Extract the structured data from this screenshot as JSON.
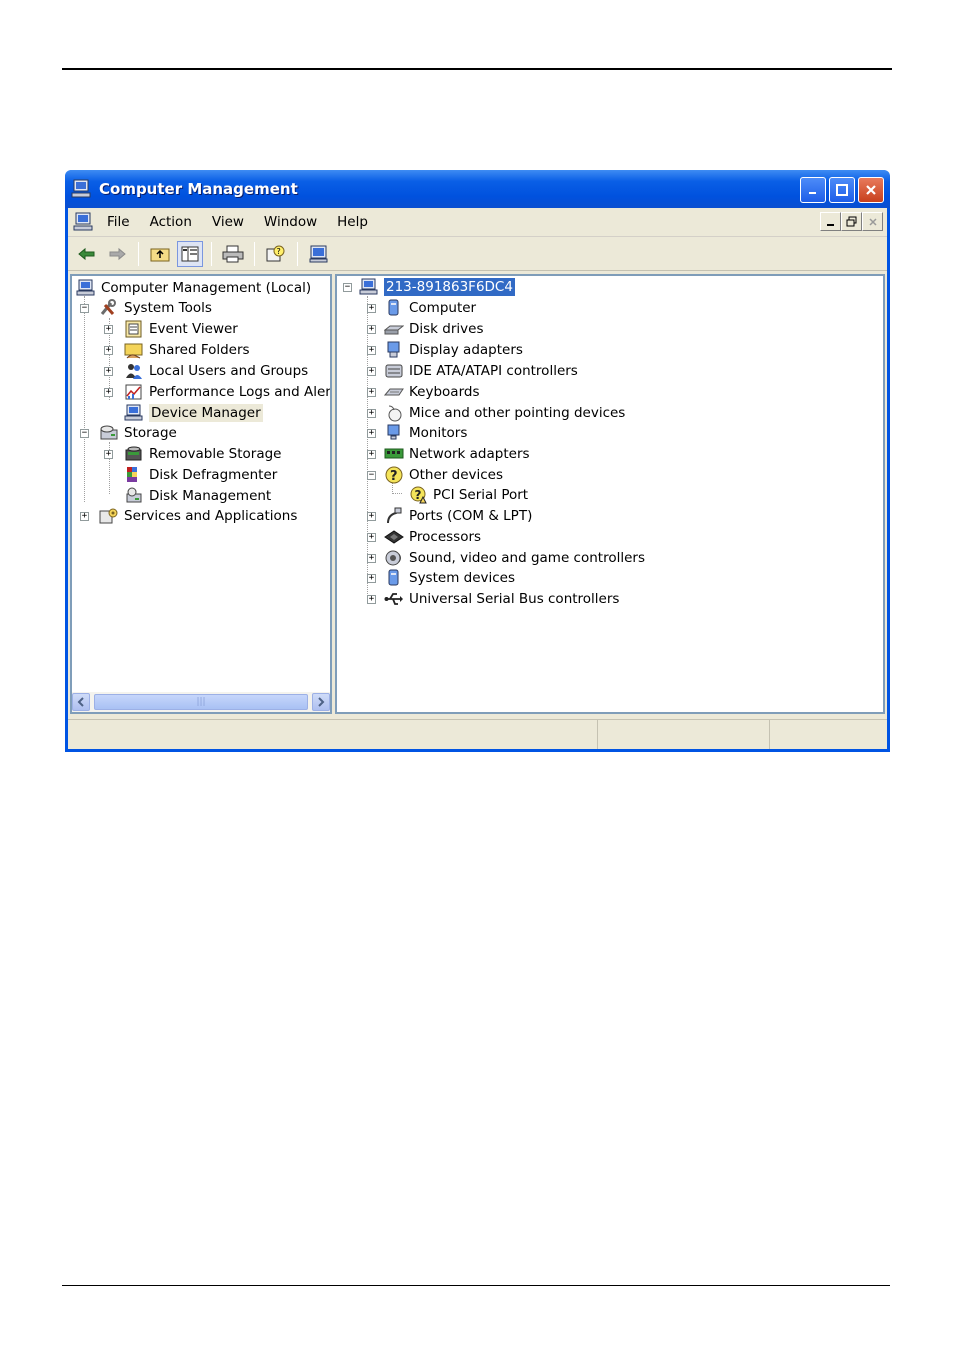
{
  "window": {
    "title": "Computer Management"
  },
  "menu": [
    "File",
    "Action",
    "View",
    "Window",
    "Help"
  ],
  "colors": {
    "titlebar": "#0054e3",
    "selection": "#316ac5",
    "face": "#ece9d8"
  },
  "toolbar_icons": [
    "back-icon",
    "forward-icon",
    "up-folder-icon",
    "show-hide-tree-icon",
    "print-icon",
    "help-icon",
    "properties-icon"
  ],
  "left_tree": {
    "root": "Computer Management (Local)",
    "system_tools": "System Tools",
    "event_viewer": "Event Viewer",
    "shared_folders": "Shared Folders",
    "local_users": "Local Users and Groups",
    "perf_logs": "Performance Logs and Alerts",
    "device_manager": "Device Manager",
    "storage": "Storage",
    "removable_storage": "Removable Storage",
    "disk_defrag": "Disk Defragmenter",
    "disk_mgmt": "Disk Management",
    "services": "Services and Applications"
  },
  "device_tree": {
    "computer_name": "213-891863F6DC4",
    "computer": "Computer",
    "disk_drives": "Disk drives",
    "display_adapters": "Display adapters",
    "ide": "IDE ATA/ATAPI controllers",
    "keyboards": "Keyboards",
    "mice": "Mice and other pointing devices",
    "monitors": "Monitors",
    "network": "Network adapters",
    "other_devices": "Other devices",
    "pci_serial": "PCI Serial Port",
    "ports": "Ports (COM & LPT)",
    "processors": "Processors",
    "sound": "Sound, video and game controllers",
    "system_devices": "System devices",
    "usb": "Universal Serial Bus controllers"
  }
}
